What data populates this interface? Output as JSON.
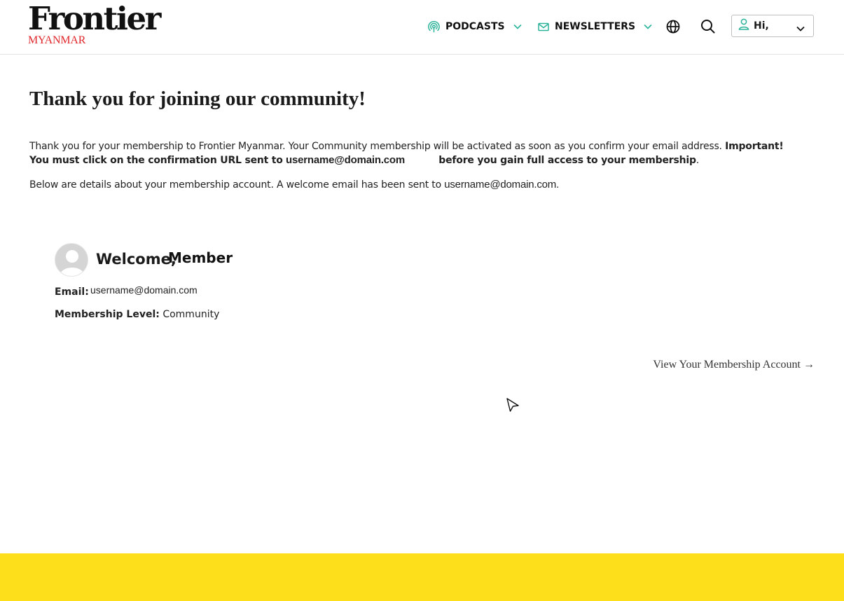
{
  "header": {
    "logo_main": "Frontier",
    "logo_sub": "MYANMAR",
    "nav": [
      {
        "label": "PODCASTS",
        "icon": "podcast-icon"
      },
      {
        "label": "NEWSLETTERS",
        "icon": "mail-icon"
      }
    ],
    "language_icon": "globe-icon",
    "search_icon": "search-icon",
    "user_menu": {
      "label": "Hi,",
      "icon": "user-icon"
    }
  },
  "main": {
    "title": "Thank you for joining our community!",
    "para1_text": "Thank you for your membership to Frontier Myanmar. Your Community membership will be activated as soon as you confirm your email address.",
    "para1_important": "Important! You must click on the confirmation URL sent to",
    "para1_email": "username@domain.com",
    "para1_tail": "before you gain full access to your membership",
    "para1_end": ".",
    "para2_text": "Below are details about your membership account. A welcome email has been sent to",
    "para2_email": "username@domain.com."
  },
  "account": {
    "welcome": "Welcome,",
    "name": "Member",
    "email_label": "Email:",
    "email_value": "username@domain.com",
    "level_label": "Membership Level:",
    "level_value": "Community",
    "view_link": "View Your Membership Account →"
  },
  "colors": {
    "accent_green": "#2bb39a",
    "logo_red": "#e0262b",
    "footer_yellow": "#fddf1b"
  }
}
